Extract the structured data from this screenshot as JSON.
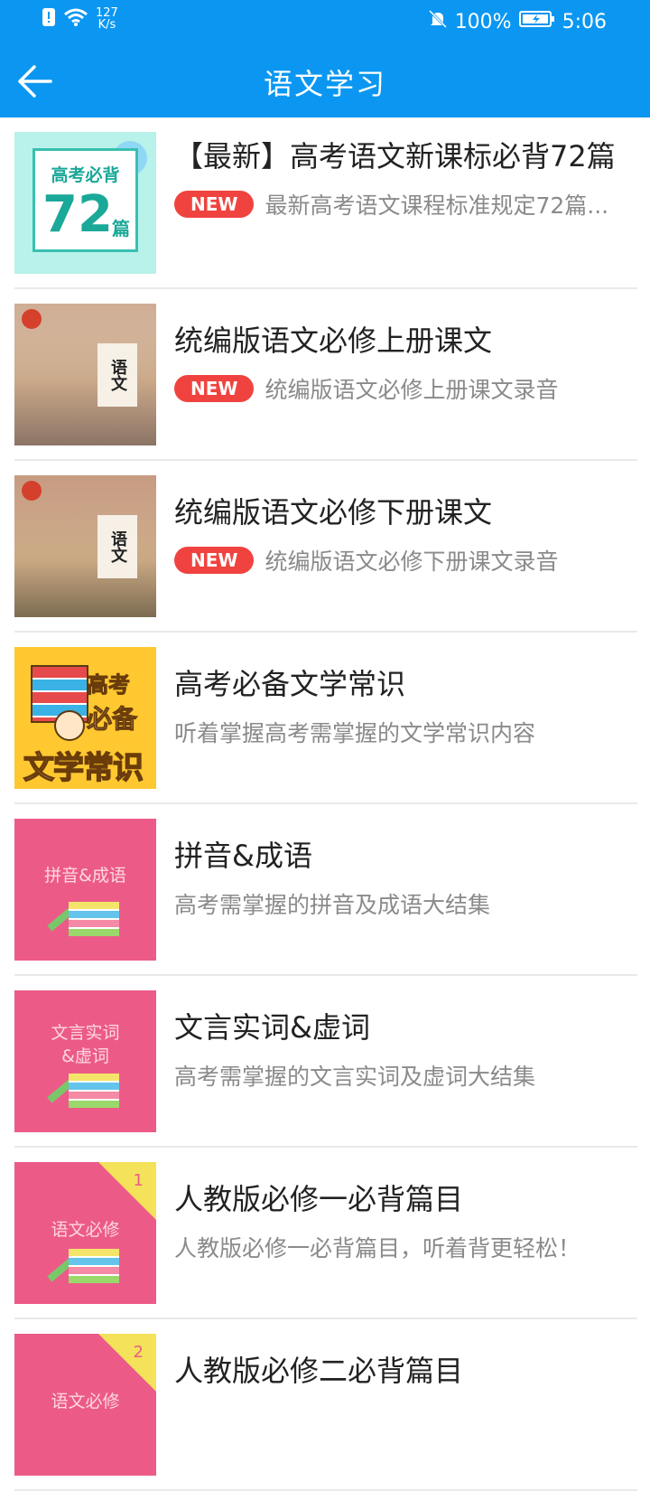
{
  "status_bar": {
    "net_speed_value": "127",
    "net_speed_unit": "K/s",
    "battery": "100%",
    "time": "5:06",
    "icons": [
      "sim-alert-icon",
      "wifi-icon",
      "mute-bell-icon",
      "battery-charging-icon"
    ]
  },
  "header": {
    "title": "语文学习",
    "back_icon": "arrow-left-icon",
    "background": "#0b97f1"
  },
  "items": [
    {
      "title": "【最新】高考语文新课标必背72篇",
      "badge": "NEW",
      "desc": "最新高考语文课程标准规定72篇...",
      "thumb": {
        "line1": "高考必背",
        "line2": "72",
        "line3": "篇"
      }
    },
    {
      "title": "统编版语文必修上册课文",
      "badge": "NEW",
      "desc": "统编版语文必修上册课文录音",
      "thumb": {
        "label": "语文"
      }
    },
    {
      "title": "统编版语文必修下册课文",
      "badge": "NEW",
      "desc": "统编版语文必修下册课文录音",
      "thumb": {
        "label": "语文"
      }
    },
    {
      "title": "高考必备文学常识",
      "desc": "听着掌握高考需掌握的文学常识内容",
      "thumb": {
        "w1": "高考",
        "w2": "必备",
        "w3": "文学常识"
      }
    },
    {
      "title": "拼音&成语",
      "desc": "高考需掌握的拼音及成语大结集",
      "thumb": {
        "text": "拼音&成语"
      }
    },
    {
      "title": "文言实词&虚词",
      "desc": "高考需掌握的文言实词及虚词大结集",
      "thumb": {
        "text1": "文言实词",
        "text2": "&虚词"
      }
    },
    {
      "title": "人教版必修一必背篇目",
      "desc": "人教版必修一必背篇目，听着背更轻松！",
      "thumb": {
        "text": "语文必修",
        "num": "1"
      }
    },
    {
      "title": "人教版必修二必背篇目",
      "thumb": {
        "text": "语文必修",
        "num": "2"
      }
    }
  ],
  "colors": {
    "badge": "#f0433f",
    "pink_thumb": "#ec5b88"
  }
}
